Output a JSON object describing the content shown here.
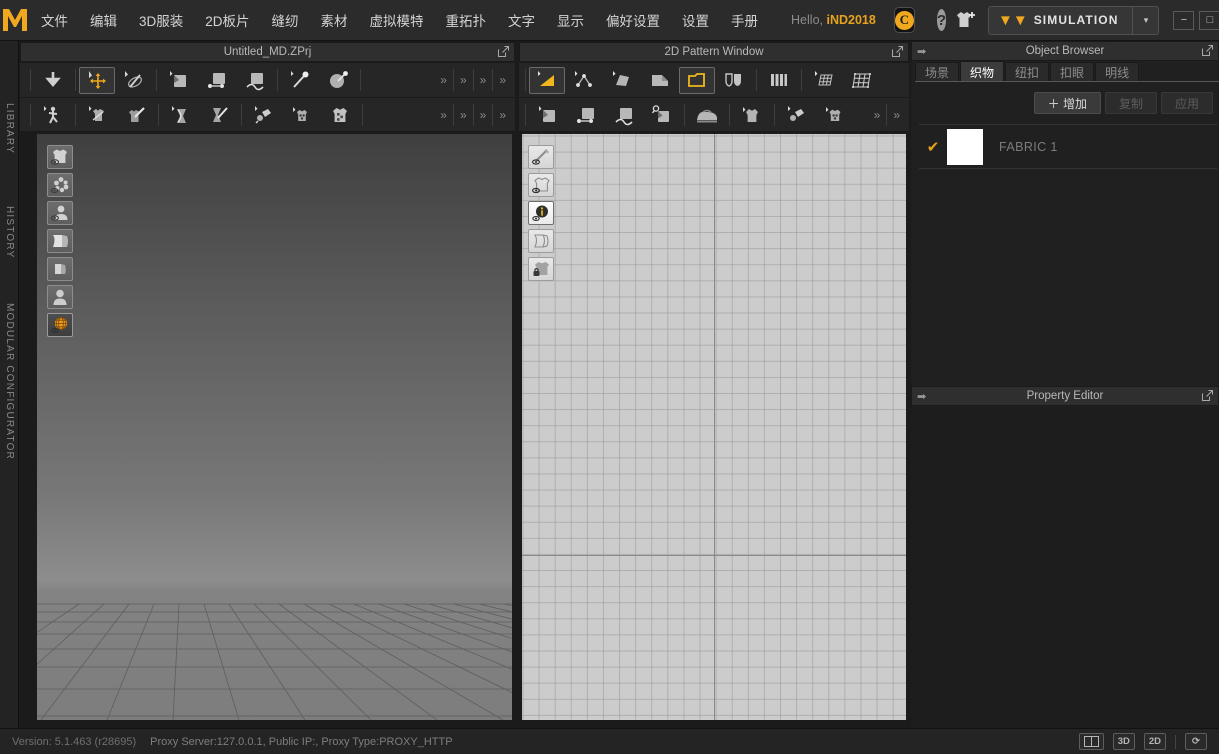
{
  "app": {
    "logo": "M",
    "brand_accent": "#f0a81e"
  },
  "menu": {
    "items": [
      {
        "label": "文件",
        "name": "menu-file"
      },
      {
        "label": "编辑",
        "name": "menu-edit"
      },
      {
        "label": "3D服装",
        "name": "menu-3d-garment"
      },
      {
        "label": "2D板片",
        "name": "menu-2d-pattern"
      },
      {
        "label": "缝纫",
        "name": "menu-sewing"
      },
      {
        "label": "素材",
        "name": "menu-material"
      },
      {
        "label": "虚拟模特",
        "name": "menu-avatar"
      },
      {
        "label": "重拓扑",
        "name": "menu-retopo"
      },
      {
        "label": "文字",
        "name": "menu-text"
      },
      {
        "label": "显示",
        "name": "menu-display"
      },
      {
        "label": "偏好设置",
        "name": "menu-preferences"
      },
      {
        "label": "设置",
        "name": "menu-settings"
      },
      {
        "label": "手册",
        "name": "menu-manual"
      }
    ],
    "greeting_prefix": "Hello, ",
    "user": "iND2018",
    "closet_icon": "C",
    "help_icon": "?",
    "simulation_label": "SIMULATION",
    "simulation_caret": "▾",
    "window_minimize": "−",
    "window_maximize": "□",
    "window_close": "×"
  },
  "left_rail": {
    "items": [
      {
        "label": "LIBRARY",
        "name": "rail-library"
      },
      {
        "label": "HISTORY",
        "name": "rail-history"
      },
      {
        "label": "MODULAR CONFIGURATOR",
        "name": "rail-modular-configurator"
      }
    ]
  },
  "viewport_3d": {
    "title": "Untitled_MD.ZPrj",
    "popout_icon": "⇱",
    "toolbar_rows": [
      {
        "groups": [
          [
            "move-gizmo-select"
          ],
          [
            "transform-tool",
            "rotate-tool"
          ],
          [
            "pattern-tool",
            "point-edit-tool",
            "curve-edit-tool"
          ],
          [
            "pin-tool",
            "sphere-pin-tool"
          ]
        ],
        "overflow": [
          "»",
          "»",
          "»",
          "»"
        ]
      },
      {
        "groups": [
          [
            "walk-avatar-tool"
          ],
          [
            "garment-fold-tool",
            "brush-tool"
          ],
          [
            "fold-arrange-tool",
            "zipper-tool"
          ],
          [
            "glue-tool",
            "button-tool",
            "fabric-tool"
          ]
        ],
        "overflow": [
          "»",
          "»",
          "»",
          "»"
        ]
      }
    ],
    "side_icons": [
      {
        "name": "show-garment-icon",
        "active": false
      },
      {
        "name": "show-particles-icon",
        "active": false
      },
      {
        "name": "show-avatar-icon",
        "active": false
      },
      {
        "name": "show-fabric-sheet-icon",
        "active": false
      },
      {
        "name": "show-fold-icon",
        "active": false
      },
      {
        "name": "avatar-head-icon",
        "active": false
      },
      {
        "name": "show-uv-globe-icon",
        "active": true
      }
    ]
  },
  "viewport_2d": {
    "title": "2D Pattern Window",
    "popout_icon": "⇱",
    "toolbar_rows": [
      {
        "groups": [
          [
            "polygon-select-tool"
          ],
          [
            "edit-point-tool",
            "edit-curve-tool",
            "polygon-tool",
            "rectangle-tool",
            "shield-pattern-tool"
          ],
          [
            "pleat-tool"
          ],
          [
            "grid-pattern-tool",
            "mesh-tool"
          ]
        ],
        "overflow": []
      },
      {
        "groups": [
          [
            "pattern-tool",
            "point-edit-tool",
            "curve-edit-tool",
            "zoom-pattern-tool"
          ],
          [
            "iron-tool"
          ],
          [
            "garment-tool"
          ],
          [
            "glue-tool",
            "button-tool"
          ]
        ],
        "overflow": [
          "»",
          "»"
        ]
      }
    ],
    "side_icons": [
      {
        "name": "show-stitch-icon",
        "active": false
      },
      {
        "name": "show-garment-outline-icon",
        "active": false
      },
      {
        "name": "show-info-icon",
        "active": true
      },
      {
        "name": "show-pattern-icon",
        "active": false
      },
      {
        "name": "lock-garment-icon",
        "active": false
      }
    ]
  },
  "object_browser": {
    "title": "Object Browser",
    "collapse_icon": "➡",
    "popout_icon": "⇱",
    "tabs": [
      {
        "label": "场景",
        "name": "tab-scene",
        "active": false
      },
      {
        "label": "织物",
        "name": "tab-fabric",
        "active": true
      },
      {
        "label": "纽扣",
        "name": "tab-button",
        "active": false
      },
      {
        "label": "扣眼",
        "name": "tab-buttonhole",
        "active": false
      },
      {
        "label": "明线",
        "name": "tab-topstitch",
        "active": false
      }
    ],
    "buttons": [
      {
        "label": "＋ 增加",
        "name": "add-button",
        "disabled": false
      },
      {
        "label": "复制",
        "name": "duplicate-button",
        "disabled": true
      },
      {
        "label": "应用",
        "name": "apply-button",
        "disabled": true
      }
    ],
    "items": [
      {
        "name": "FABRIC 1",
        "checked": true,
        "check_glyph": "✔",
        "swatch_color": "#ffffff"
      }
    ]
  },
  "property_editor": {
    "title": "Property Editor",
    "collapse_icon": "➡",
    "popout_icon": "⇱"
  },
  "status_bar": {
    "version": "Version: 5.1.463 (r28695)",
    "proxy": "Proxy Server:127.0.0.1, Public IP:, Proxy Type:PROXY_HTTP",
    "buttons": [
      {
        "label": "",
        "name": "split-view-button"
      },
      {
        "label": "3D",
        "name": "view-3d-button"
      },
      {
        "label": "2D",
        "name": "view-2d-button"
      },
      {
        "label": "⟳",
        "name": "refresh-button"
      }
    ]
  }
}
